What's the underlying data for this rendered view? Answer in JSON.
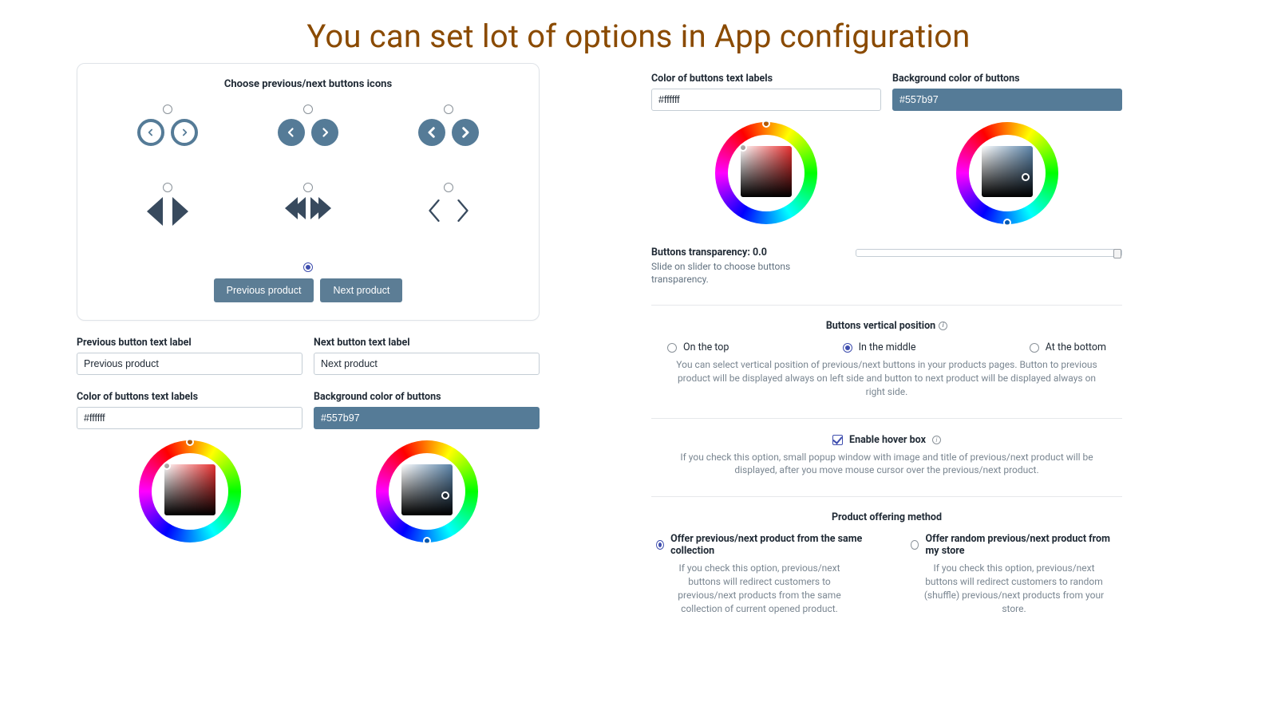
{
  "page_title": "You can set lot of options in App configuration",
  "icon_card": {
    "title": "Choose previous/next buttons icons",
    "selected_index": 6,
    "preview_prev": "Previous product",
    "preview_next": "Next product"
  },
  "labels": {
    "prev_label_title": "Previous button text label",
    "next_label_title": "Next button text label",
    "prev_label_value": "Previous product",
    "next_label_value": "Next product",
    "text_color_title": "Color of buttons text labels",
    "text_color_value": "#ffffff",
    "bg_color_title": "Background color of buttons",
    "bg_color_value": "#557b97"
  },
  "right": {
    "text_color_title": "Color of buttons text labels",
    "text_color_value": "#ffffff",
    "bg_color_title": "Background color of buttons",
    "bg_color_value": "#557b97",
    "transparency_title": "Buttons transparency: 0.0",
    "transparency_sub": "Slide on slider to choose buttons transparency.",
    "vpos_title": "Buttons vertical position",
    "vpos_options": {
      "top": "On the top",
      "middle": "In the middle",
      "bottom": "At the bottom"
    },
    "vpos_selected": "middle",
    "vpos_desc": "You can select vertical position of previous/next buttons in your products pages. Button to previous product will be displayed always on left side and button to next product will be displayed always on right side.",
    "hover_label": "Enable hover box",
    "hover_checked": true,
    "hover_desc": "If you check this option, small popup window with image and title of previous/next product will be displayed, after you move mouse cursor over the previous/next product.",
    "offer_title": "Product offering method",
    "offer_same": "Offer previous/next product from the same collection",
    "offer_same_desc": "If you check this option, previous/next buttons will redirect customers to previous/next products from the same collection of current opened product.",
    "offer_random": "Offer random previous/next product from my store",
    "offer_random_desc": "If you check this option, previous/next buttons will redirect customers to random (shuffle) previous/next products from your store.",
    "offer_selected": "same"
  }
}
